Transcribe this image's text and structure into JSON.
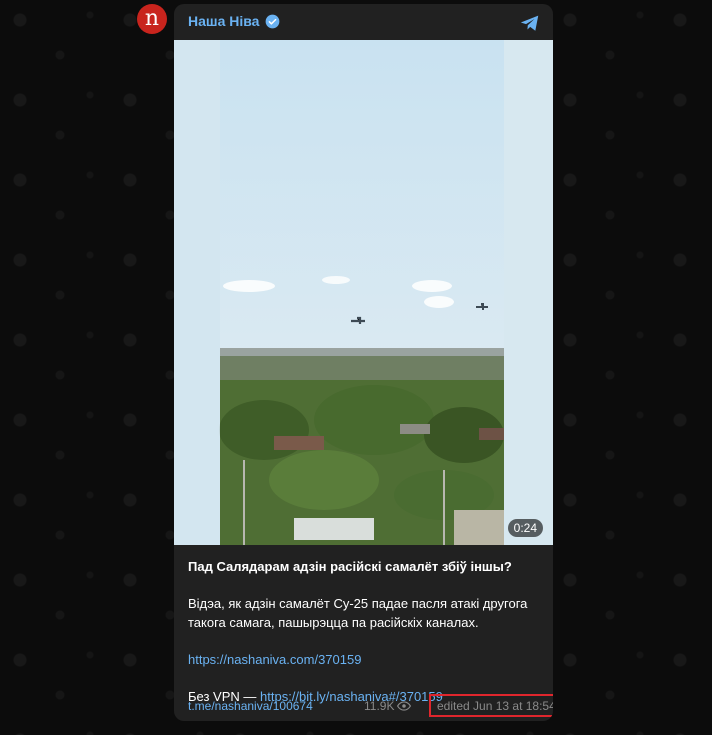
{
  "channel": {
    "name": "Наша Ніва",
    "avatar_letter": "n",
    "avatar_color": "#c8241d"
  },
  "video": {
    "duration": "0:24"
  },
  "post": {
    "title": "Пад Салядарам адзін расійскі самалёт збіў іншы?",
    "body": "Відэа, як адзін самалёт Су-25 падае пасля атакі другога такога самага, пашырэцца па расійскіх каналах.",
    "link": "https://nashaniva.com/370159",
    "vpn_prefix": "Без VPN — ",
    "vpn_link": "https://bit.ly/nashaniva#/370159"
  },
  "footer": {
    "post_link": "t.me/nashaniva/100674",
    "views": "11.9K",
    "edited": "edited  Jun 13 at 18:54"
  },
  "colors": {
    "accent": "#6ab2f2",
    "card_bg": "#212121",
    "highlight": "#e0262d"
  }
}
